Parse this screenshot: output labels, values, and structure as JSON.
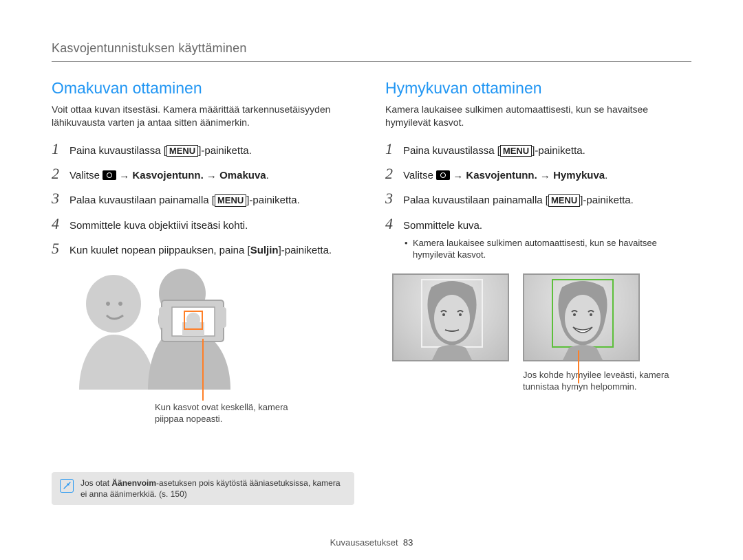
{
  "breadcrumb": "Kasvojentunnistuksen käyttäminen",
  "left": {
    "title": "Omakuvan ottaminen",
    "intro": "Voit ottaa kuvan itsestäsi. Kamera määrittää tarkennusetäisyyden lähikuvausta varten ja antaa sitten äänimerkin.",
    "steps": {
      "s1_a": "Paina kuvaustilassa [",
      "s1_menu": "MENU",
      "s1_b": "]-painiketta.",
      "s2_a": "Valitse ",
      "s2_b": " → Kasvojentunn. → Omakuva",
      "s2_c": ".",
      "s3_a": "Palaa kuvaustilaan painamalla [",
      "s3_menu": "MENU",
      "s3_b": "]-painiketta.",
      "s4": "Sommittele kuva objektiivi itseäsi kohti.",
      "s5_a": "Kun kuulet nopean piippauksen, paina [",
      "s5_b": "Suljin",
      "s5_c": "]-painiketta."
    },
    "callout": "Kun kasvot ovat keskellä, kamera piippaa nopeasti.",
    "note_a": "Jos otat ",
    "note_b": "Äänenvoim",
    "note_c": "-asetuksen pois käytöstä ääniasetuksissa, kamera ei anna äänimerkkiä. (s. 150)"
  },
  "right": {
    "title": "Hymykuvan ottaminen",
    "intro": "Kamera laukaisee sulkimen automaattisesti, kun se havaitsee hymyilevät kasvot.",
    "steps": {
      "s1_a": "Paina kuvaustilassa [",
      "s1_menu": "MENU",
      "s1_b": "]-painiketta.",
      "s2_a": "Valitse ",
      "s2_b": " → Kasvojentunn. → Hymykuva",
      "s2_c": ".",
      "s3_a": "Palaa kuvaustilaan painamalla [",
      "s3_menu": "MENU",
      "s3_b": "]-painiketta.",
      "s4": "Sommittele kuva.",
      "s4_sub": "Kamera laukaisee sulkimen automaattisesti, kun se havaitsee hymyilevät kasvot."
    },
    "callout": "Jos kohde hymyilee leveästi, kamera tunnistaa hymyn helpommin."
  },
  "footer": {
    "label": "Kuvausasetukset",
    "page": "83"
  },
  "nums": {
    "n1": "1",
    "n2": "2",
    "n3": "3",
    "n4": "4",
    "n5": "5"
  }
}
